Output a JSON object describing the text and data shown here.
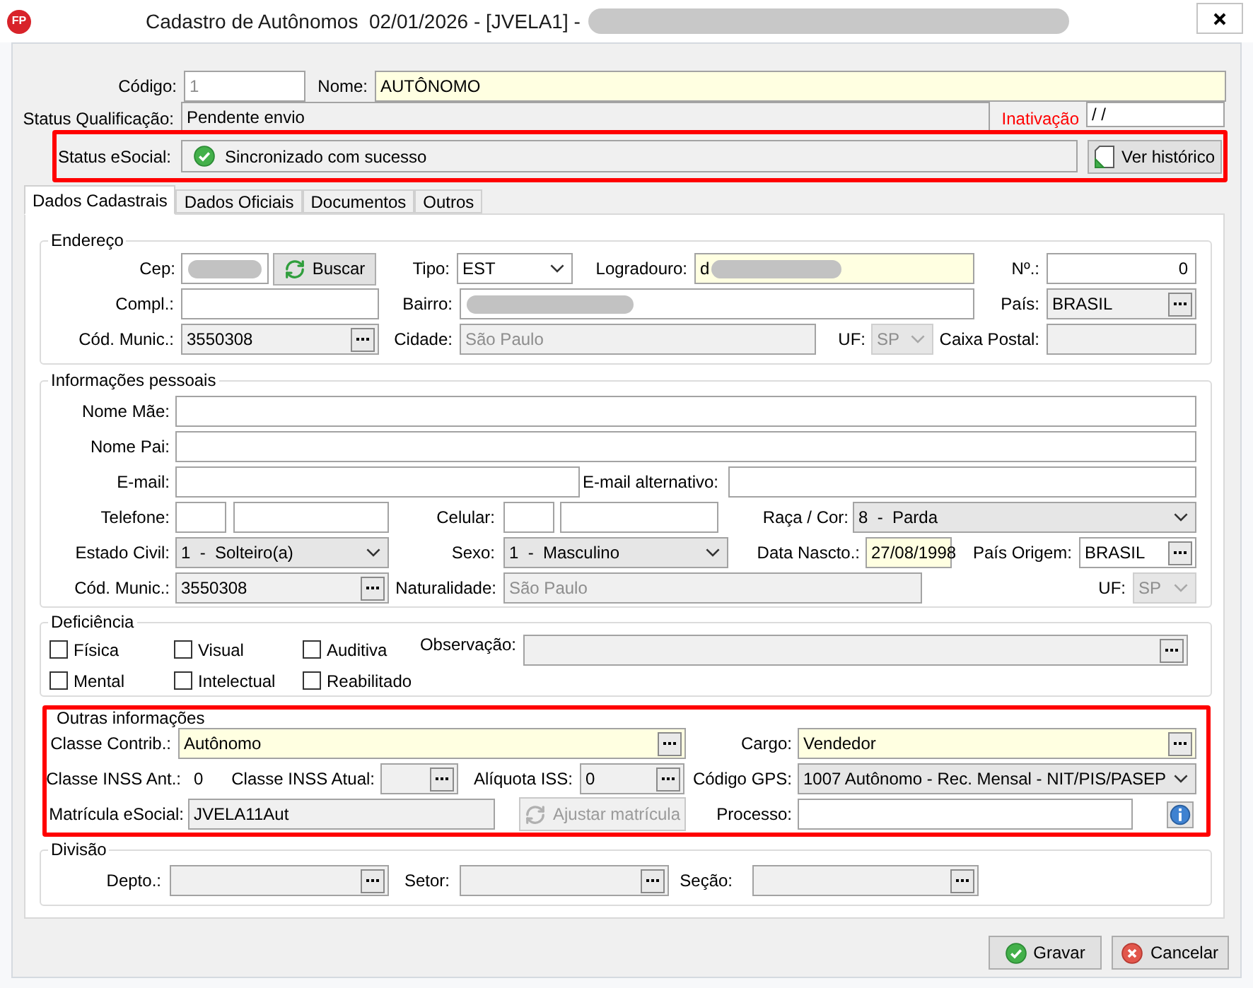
{
  "window": {
    "logo": "FP",
    "title": "Cadastro de Autônomos  02/01/2026 - [JVELA1] -",
    "title_redacted": true
  },
  "header": {
    "codigo": {
      "label": "Código:",
      "value": "1",
      "disabled": true
    },
    "nome": {
      "label": "Nome:",
      "value": "AUTÔNOMO",
      "required": true
    },
    "status_qualificacao": {
      "label": "Status Qualificação:",
      "value": "Pendente envio",
      "readonly": true
    },
    "inativacao": {
      "label": "Inativação",
      "value": "/ /"
    },
    "status_esocial": {
      "label": "Status eSocial:",
      "value": "Sincronizado com sucesso",
      "readonly": true,
      "highlighted": true
    },
    "ver_historico": "Ver histórico"
  },
  "tabs": [
    {
      "label": "Dados Cadastrais",
      "selected": true
    },
    {
      "label": "Dados Oficiais",
      "selected": false
    },
    {
      "label": "Documentos",
      "selected": false
    },
    {
      "label": "Outros",
      "selected": false
    }
  ],
  "endereco": {
    "title": "Endereço",
    "cep": {
      "label": "Cep:",
      "redacted": true
    },
    "buscar": "Buscar",
    "tipo": {
      "label": "Tipo:",
      "value": "EST"
    },
    "logradouro": {
      "label": "Logradouro:",
      "value": "d",
      "required": true,
      "redacted": true
    },
    "numero": {
      "label": "Nº.:",
      "value": "0"
    },
    "compl": {
      "label": "Compl.:"
    },
    "bairro": {
      "label": "Bairro:",
      "redacted": true
    },
    "pais": {
      "label": "País:",
      "value": "BRASIL",
      "readonly": true
    },
    "cod_munic": {
      "label": "Cód. Munic.:",
      "value": "3550308",
      "readonly": true
    },
    "cidade": {
      "label": "Cidade:",
      "value": "São Paulo",
      "readonly": true,
      "disabled": true
    },
    "uf": {
      "label": "UF:",
      "value": "SP",
      "readonly": true,
      "disabled": true
    },
    "caixa_postal": {
      "label": "Caixa Postal:",
      "readonly": true
    }
  },
  "info_pessoais": {
    "title": "Informações pessoais",
    "nome_mae": {
      "label": "Nome Mãe:"
    },
    "nome_pai": {
      "label": "Nome Pai:"
    },
    "email": {
      "label": "E-mail:"
    },
    "email_alt": {
      "label": "E-mail alternativo:"
    },
    "telefone": {
      "label": "Telefone:"
    },
    "celular": {
      "label": "Celular:"
    },
    "raca_cor": {
      "label": "Raça / Cor:",
      "value": "8  -  Parda",
      "readonly": true
    },
    "estado_civil": {
      "label": "Estado Civil:",
      "value": "1  -  Solteiro(a)",
      "readonly": true
    },
    "sexo": {
      "label": "Sexo:",
      "value": "1  -  Masculino",
      "readonly": true
    },
    "data_nascto": {
      "label": "Data Nascto.:",
      "value": "27/08/1998",
      "required": true
    },
    "pais_origem": {
      "label": "País Origem:",
      "value": "BRASIL"
    },
    "cod_munic": {
      "label": "Cód. Munic.:",
      "value": "3550308",
      "readonly": true
    },
    "naturalidade": {
      "label": "Naturalidade:",
      "value": "São Paulo",
      "readonly": true,
      "disabled": true
    },
    "uf": {
      "label": "UF:",
      "value": "SP",
      "readonly": true,
      "disabled": true
    }
  },
  "deficiencia": {
    "title": "Deficiência",
    "options": [
      {
        "label": "Física",
        "checked": false
      },
      {
        "label": "Visual",
        "checked": false
      },
      {
        "label": "Auditiva",
        "checked": false
      },
      {
        "label": "Mental",
        "checked": false
      },
      {
        "label": "Intelectual",
        "checked": false
      },
      {
        "label": "Reabilitado",
        "checked": false
      }
    ],
    "observacao": {
      "label": "Observação:",
      "readonly": true
    }
  },
  "outras": {
    "title": "Outras informações",
    "highlighted": true,
    "classe_contrib": {
      "label": "Classe Contrib.:",
      "value": "Autônomo",
      "required": true
    },
    "cargo": {
      "label": "Cargo:",
      "value": "Vendedor",
      "required": true
    },
    "classe_inss_ant": {
      "label": "Classe INSS Ant.:",
      "value": "0"
    },
    "classe_inss_atual": {
      "label": "Classe INSS Atual:",
      "readonly": true
    },
    "aliquota_iss": {
      "label": "Alíquota ISS:",
      "value": "0",
      "readonly": true
    },
    "codigo_gps": {
      "label": "Código GPS:",
      "value": "1007 Autônomo - Rec. Mensal - NIT/PIS/PASEP",
      "readonly": true
    },
    "matricula": {
      "label": "Matrícula eSocial:",
      "value": "JVELA11Aut",
      "readonly": true
    },
    "ajustar": {
      "label": "Ajustar matrícula",
      "disabled": true
    },
    "processo": {
      "label": "Processo:"
    }
  },
  "divisao": {
    "title": "Divisão",
    "depto": {
      "label": "Depto.:",
      "readonly": true
    },
    "setor": {
      "label": "Setor:",
      "readonly": true
    },
    "secao": {
      "label": "Seção:",
      "readonly": true
    }
  },
  "buttons": [
    {
      "label": "Gravar",
      "kind": "confirm"
    },
    {
      "label": "Cancelar",
      "kind": "cancel"
    }
  ]
}
